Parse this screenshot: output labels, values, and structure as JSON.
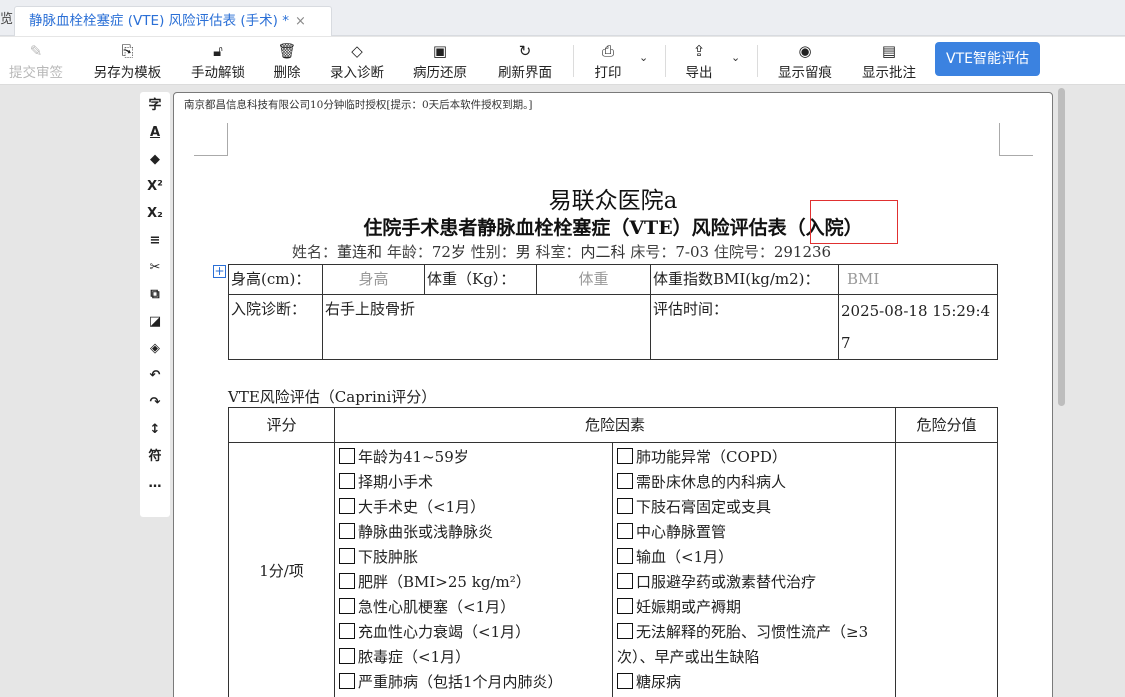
{
  "tabs": {
    "prev_tab_fragment": "览",
    "active_tab_label": "静脉血栓栓塞症 (VTE) 风险评估表 (手术) *",
    "close_symbol": "×"
  },
  "toolbar": {
    "submit_sign": "提交审签",
    "save_as_template": "另存为模板",
    "manual_unlock": "手动解锁",
    "delete": "删除",
    "enter_diagnosis": "录入诊断",
    "restore_record": "病历还原",
    "refresh": "刷新界面",
    "print": "打印",
    "export": "导出",
    "show_trace": "显示留痕",
    "show_comments": "显示批注",
    "vte_assess": "VTE智能评估"
  },
  "side_tools": [
    "字",
    "A",
    "◆",
    "X²",
    "X₂",
    "≡",
    "✂",
    "⧉",
    "◪",
    "◈",
    "↶",
    "↷",
    "↕",
    "符",
    "…"
  ],
  "document": {
    "license_notice": "南京都昌信息科技有限公司10分钟临时授权[提示：0天后本软件授权到期。]",
    "hospital_name": "易联众医院a",
    "form_title": "住院手术患者静脉血栓栓塞症（VTE）风险评估表（入院）",
    "patient": {
      "name_label": "姓名：",
      "name": "董连和",
      "age_label": "年龄：",
      "age": "72岁",
      "sex_label": "性别：",
      "sex": "男",
      "dept_label": "科室：",
      "dept": "内二科",
      "bed_label": "床号：",
      "bed": "7-03",
      "admission_label": "住院号：",
      "admission_no": "291236"
    },
    "basic_table": {
      "height_label": "身高(cm)：",
      "height_placeholder": "身高",
      "weight_label": "体重（Kg）：",
      "weight_placeholder": "体重",
      "bmi_label": "体重指数BMI(kg/m2)：",
      "bmi_placeholder": "BMI",
      "diagnosis_label": "入院诊断：",
      "diagnosis_value": "右手上肢骨折",
      "assess_time_label": "评估时间：",
      "assess_time_value": "2025-08-18 15:29:47"
    },
    "caprini": {
      "section_title": "VTE风险评估（Caprini评分）",
      "col_score": "评分",
      "col_factors": "危险因素",
      "col_value": "危险分值",
      "row_score": "1分/项",
      "left_items": [
        "年龄为41~59岁",
        "择期小手术",
        "大手术史（<1月）",
        "静脉曲张或浅静脉炎",
        "下肢肿胀",
        "肥胖（BMI>25 kg/m²）",
        "急性心肌梗塞（<1月）",
        "充血性心力衰竭（<1月）",
        "脓毒症（<1月）",
        "严重肺病（包括1个月内肺炎）"
      ],
      "right_items": [
        "肺功能异常（COPD）",
        "需卧床休息的内科病人",
        "下肢石膏固定或支具",
        "中心静脉置管",
        "输血（<1月）",
        "口服避孕药或激素替代治疗",
        "妊娠期或产褥期",
        "无法解释的死胎、习惯性流产（≥3次）、早产或出生缺陷",
        "糖尿病"
      ]
    }
  }
}
